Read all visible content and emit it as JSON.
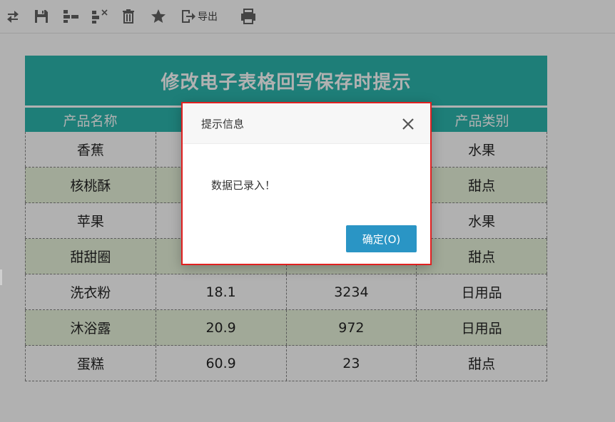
{
  "toolbar": {
    "items": [
      {
        "icon": "refresh-icon"
      },
      {
        "icon": "save-icon"
      },
      {
        "icon": "insert-row-icon"
      },
      {
        "icon": "delete-row-icon"
      },
      {
        "icon": "trash-icon"
      },
      {
        "icon": "star-icon"
      },
      {
        "icon": "export-icon",
        "label": "导出"
      },
      {
        "icon": "print-icon"
      }
    ]
  },
  "report": {
    "title": "修改电子表格回写保存时提示",
    "headers": [
      "产品名称",
      "",
      "",
      "产品类别"
    ],
    "rows": [
      [
        "香蕉",
        "",
        "",
        "水果"
      ],
      [
        "核桃酥",
        "",
        "",
        "甜点"
      ],
      [
        "苹果",
        "",
        "",
        "水果"
      ],
      [
        "甜甜圈",
        "",
        "",
        "甜点"
      ],
      [
        "洗衣粉",
        "18.1",
        "3234",
        "日用品"
      ],
      [
        "沐浴露",
        "20.9",
        "972",
        "日用品"
      ],
      [
        "蛋糕",
        "60.9",
        "23",
        "甜点"
      ]
    ],
    "colors": {
      "header_bg": "#1ab0a6",
      "alt_row_bg": "#e6f2d8"
    }
  },
  "dialog": {
    "title": "提示信息",
    "message": "数据已录入！",
    "ok_label": "确定(O)",
    "close_icon": "close-icon",
    "colors": {
      "ok_bg": "#2a95c5",
      "highlight_border": "#e02020"
    }
  }
}
